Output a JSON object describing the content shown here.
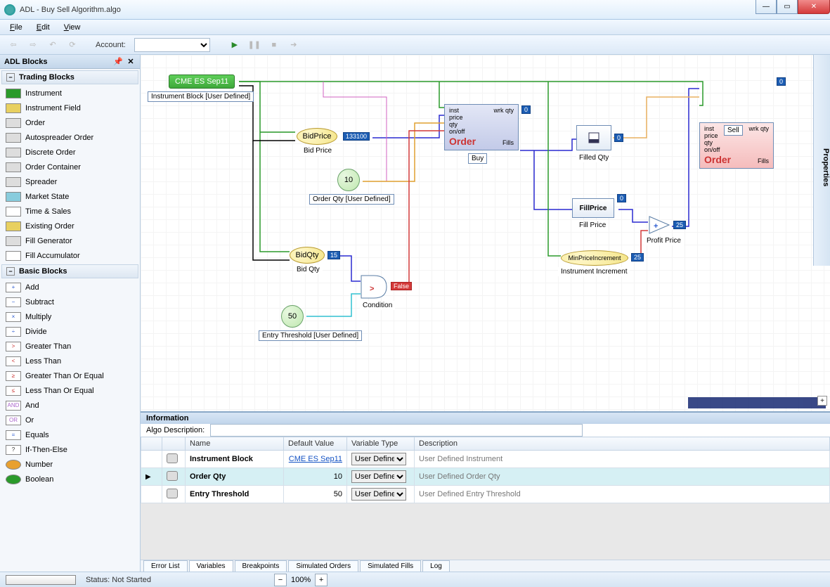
{
  "window": {
    "title": "ADL - Buy Sell Algorithm.algo"
  },
  "menu": {
    "file": "File",
    "edit": "Edit",
    "view": "View"
  },
  "toolbar": {
    "account_label": "Account:"
  },
  "sidebar": {
    "title": "ADL Blocks",
    "cat_trading": "Trading Blocks",
    "trading_items": [
      "Instrument",
      "Instrument Field",
      "Order",
      "Autospreader Order",
      "Discrete Order",
      "Order Container",
      "Spreader",
      "Market State",
      "Time & Sales",
      "Existing Order",
      "Fill Generator",
      "Fill Accumulator"
    ],
    "cat_basic": "Basic Blocks",
    "basic_items": [
      "Add",
      "Subtract",
      "Multiply",
      "Divide",
      "Greater Than",
      "Less Than",
      "Greater Than Or Equal",
      "Less Than Or Equal",
      "And",
      "Or",
      "Equals",
      "If-Then-Else",
      "Number",
      "Boolean"
    ]
  },
  "canvas": {
    "instrument": {
      "text": "CME ES Sep11",
      "label": "Instrument Block [User Defined]"
    },
    "bidprice": {
      "name": "BidPrice",
      "label": "Bid Price",
      "val": "133100"
    },
    "bidqty": {
      "name": "BidQty",
      "label": "Bid Qty",
      "val": "15"
    },
    "orderqty": {
      "name": "10",
      "label": "Order Qty [User Defined]"
    },
    "entrythresh": {
      "name": "50",
      "label": "Entry Threshold [User Defined]"
    },
    "condition": {
      "label": "Condition",
      "val": "False"
    },
    "orderbuy": {
      "label": "Buy",
      "inputs": [
        "inst",
        "price",
        "qty",
        "on/off"
      ],
      "wrkqty": "wrk qty",
      "wrkqty_val": "0",
      "fills": "Fills"
    },
    "ordersell": {
      "label": "Sell",
      "inputs": [
        "inst",
        "price",
        "qty",
        "on/off"
      ],
      "wrkqty": "wrk qty",
      "wrkqty_val": "0",
      "fills": "Fills"
    },
    "filledqty": {
      "label": "Filled Qty",
      "val": "0"
    },
    "fillprice": {
      "name": "FillPrice",
      "label": "Fill Price",
      "val": "0"
    },
    "minprice": {
      "name": "MinPriceIncrement",
      "label": "Instrument Increment",
      "val": "25"
    },
    "profitprice": {
      "label": "Profit Price",
      "val": "25"
    },
    "ordertxt": "Order"
  },
  "info": {
    "title": "Information",
    "algo_desc_label": "Algo Description:",
    "columns": {
      "name": "Name",
      "default": "Default Value",
      "vtype": "Variable Type",
      "desc": "Description"
    },
    "rows": [
      {
        "name": "Instrument Block",
        "default": "CME ES Sep11",
        "vtype": "User Defined",
        "desc": "User Defined Instrument",
        "is_link": true
      },
      {
        "name": "Order Qty",
        "default": "10",
        "vtype": "User Defined",
        "desc": "User Defined Order Qty",
        "selected": true
      },
      {
        "name": "Entry Threshold",
        "default": "50",
        "vtype": "User Defined",
        "desc": "User Defined Entry Threshold"
      }
    ],
    "tabs": [
      "Error List",
      "Variables",
      "Breakpoints",
      "Simulated Orders",
      "Simulated Fills",
      "Log"
    ],
    "active_tab": "Variables"
  },
  "status": {
    "text": "Status: Not Started",
    "zoom": "100%"
  },
  "properties": {
    "label": "Properties"
  }
}
